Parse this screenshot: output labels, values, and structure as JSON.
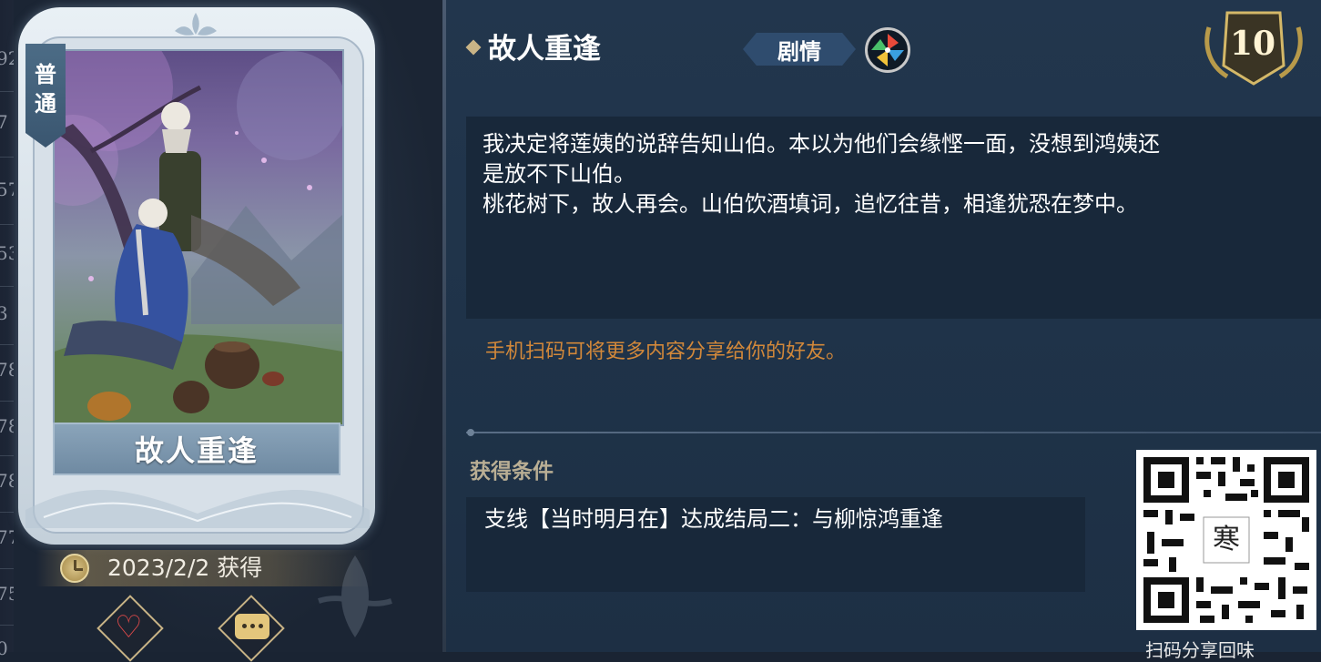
{
  "left_strip": {
    "numbers": [
      "92",
      "7",
      "57",
      "53",
      "3",
      "78",
      "78",
      "78",
      "77",
      "75",
      "0"
    ]
  },
  "card": {
    "rarity": [
      "普",
      "通"
    ],
    "title": "故人重逢",
    "obtained_date": "2023/2/2",
    "obtained_label": "获得"
  },
  "actions": {
    "like_icon": "heart-icon",
    "comment_icon": "chat-bubble-icon"
  },
  "event": {
    "title": "故人重逢",
    "tag": "剧情",
    "tag_icon": "pinwheel-icon",
    "level": "10",
    "description": "我决定将莲姨的说辞告知山伯。本以为他们会缘悭一面，没想到鸿姨还\n是放不下山伯。\n桃花树下，故人再会。山伯饮酒填词，追忆往昔，相逢犹恐在梦中。",
    "share_tip": "手机扫码可将更多内容分享给你的好友。",
    "condition_heading": "获得条件",
    "condition": "支线【当时明月在】达成结局二：与柳惊鸿重逢",
    "qr_label": "扫码分享回味"
  },
  "colors": {
    "panel_bg": "#1f3349",
    "text_box_bg": "#18283a",
    "share_tip": "#d2883a",
    "heading_gold": "#b9ae94",
    "card_frame": "#d6e0e8",
    "tag_bg": "#2f4c6e"
  }
}
